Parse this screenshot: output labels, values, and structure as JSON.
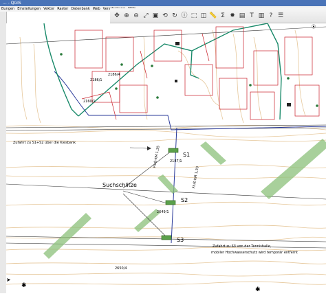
{
  "window": {
    "title": "... - QGIS"
  },
  "menu": [
    "Projekt",
    "Bearbeiten",
    "Ansicht",
    "Layer",
    "Einstellungen",
    "Erweiterungen",
    "Vektor",
    "Raster",
    "Datenbank",
    "Web",
    "Verarbeitung",
    "Hilfe"
  ],
  "menu_visible": [
    "Bungen",
    "Einstellungen",
    "Vektor",
    "Raster",
    "Datenbank",
    "Web",
    "Verarbeitung",
    "Hilfe"
  ],
  "toolbar_icons": [
    "pan-icon",
    "zoom-in-icon",
    "zoom-out-icon",
    "zoom-full-icon",
    "zoom-layer-icon",
    "refresh-icon",
    "identify-icon",
    "select-icon",
    "deselect-icon",
    "measure-icon",
    "sum-icon",
    "help-icon",
    "annotation-icon",
    "text-icon",
    "bookmark-icon",
    "tips-icon"
  ],
  "map": {
    "parcels": [
      "2186/1",
      "2186/4",
      "2160/1",
      "2187/1",
      "2649/1",
      "2650/4"
    ],
    "stations": [
      {
        "label": "S1"
      },
      {
        "label": "S2"
      },
      {
        "label": "S3"
      }
    ],
    "annotations": {
      "zufahrt_s1s2": "Zufahrt zu S1+S2 über die Kiesbank",
      "suchschlitze": "Suchschlitze",
      "zufahrt_s3_line1": "Zufahrt zu S3 von der Tennishalle,",
      "zufahrt_s3_line2": "mobiler Hochwasserschutz wird temporär entfernt",
      "fluss_km_1": "Fluß-KM 1,35",
      "fluss_km_2": "Fluß-KM 1,30"
    }
  },
  "colors": {
    "contour": "#e6c79a",
    "parcel_red": "#c8202a",
    "teal_line": "#1a8a6a",
    "blue_line": "#2a3a9a",
    "green_band": "#8bc07a",
    "station_fill": "#5aa04a",
    "title_bar": "#4a74b8"
  }
}
